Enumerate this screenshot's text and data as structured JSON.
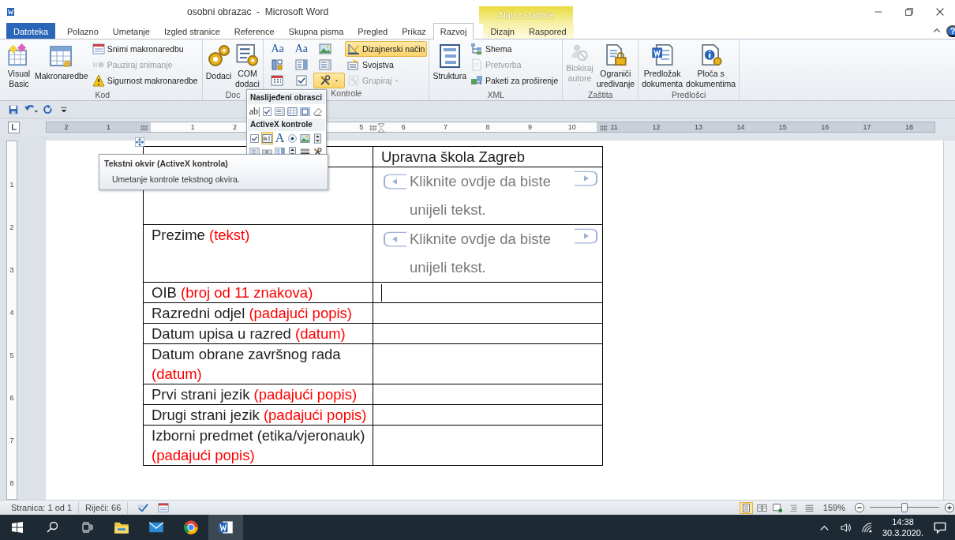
{
  "window": {
    "title": "osobni obrazac  -  Microsoft Word",
    "context_group": "Alati za tablice"
  },
  "tabs": [
    {
      "label": "Datoteka",
      "kind": "file",
      "selected": false
    },
    {
      "label": "Polazno",
      "kind": "tab",
      "selected": false
    },
    {
      "label": "Umetanje",
      "kind": "tab",
      "selected": false
    },
    {
      "label": "Izgled stranice",
      "kind": "tab",
      "selected": false
    },
    {
      "label": "Reference",
      "kind": "tab",
      "selected": false
    },
    {
      "label": "Skupna pisma",
      "kind": "tab",
      "selected": false
    },
    {
      "label": "Pregled",
      "kind": "tab",
      "selected": false
    },
    {
      "label": "Prikaz",
      "kind": "tab",
      "selected": false
    },
    {
      "label": "Razvoj",
      "kind": "tab",
      "selected": true
    },
    {
      "label": "Dizajn",
      "kind": "context",
      "selected": false
    },
    {
      "label": "Raspored",
      "kind": "context",
      "selected": false
    }
  ],
  "help_label": "?",
  "ribbon": {
    "groups": [
      {
        "label": "Kod",
        "columns": [
          {
            "kind": "large",
            "items": [
              {
                "kind": "vb",
                "label": "Visual\nBasic",
                "disabled": false,
                "on": false,
                "dropdown": false
              }
            ]
          },
          {
            "kind": "large",
            "items": [
              {
                "kind": "sheet",
                "label": "Makronaredbe",
                "disabled": false,
                "on": false,
                "dropdown": false
              }
            ]
          },
          {
            "kind": "small",
            "items": [
              {
                "kind": "record",
                "label": "Snimi makronaredbu",
                "disabled": false,
                "on": false,
                "dropdown": false
              },
              {
                "kind": "pause",
                "label": "Pauziraj snimanje",
                "disabled": true,
                "on": false,
                "dropdown": false
              },
              {
                "kind": "warning",
                "label": "Sigurnost makronaredbe",
                "disabled": false,
                "on": false,
                "dropdown": false
              }
            ]
          }
        ]
      },
      {
        "label": "Doc",
        "columns": [
          {
            "kind": "large",
            "items": [
              {
                "kind": "gears",
                "label": "Dodaci",
                "disabled": false,
                "on": false,
                "dropdown": false
              }
            ]
          },
          {
            "kind": "large",
            "items": [
              {
                "kind": "listgear",
                "label": "COM\ndodaci",
                "disabled": false,
                "on": false,
                "dropdown": false
              }
            ]
          }
        ]
      },
      {
        "label": "Kontrole",
        "columns": [
          {
            "kind": "small",
            "items": [
              {
                "kind": "glyph",
                "text": "Aa",
                "disabled": false,
                "on": false,
                "dropdown": false
              },
              {
                "kind": "blocks",
                "disabled": false,
                "on": false,
                "dropdown": false
              },
              {
                "kind": "calendar",
                "disabled": false,
                "on": false,
                "dropdown": false
              }
            ]
          },
          {
            "kind": "small",
            "items": [
              {
                "kind": "glyph",
                "text": "Aa",
                "disabled": false,
                "on": false,
                "dropdown": false
              },
              {
                "kind": "combo",
                "disabled": false,
                "on": false,
                "dropdown": false
              },
              {
                "kind": "checkbox",
                "disabled": false,
                "on": false,
                "dropdown": false
              }
            ]
          },
          {
            "kind": "small",
            "items": [
              {
                "kind": "picture",
                "disabled": false,
                "on": false,
                "dropdown": false
              },
              {
                "kind": "listbox",
                "disabled": false,
                "on": false,
                "dropdown": false
              },
              {
                "kind": "tools",
                "disabled": false,
                "on": true,
                "dropdown": true
              }
            ]
          },
          {
            "kind": "small",
            "items": [
              {
                "kind": "design",
                "label": "Dizajnerski način",
                "disabled": false,
                "on": true,
                "dropdown": false
              },
              {
                "kind": "props",
                "label": "Svojstva",
                "disabled": false,
                "on": false,
                "dropdown": false
              },
              {
                "kind": "group",
                "label": "Grupiraj",
                "disabled": true,
                "on": false,
                "dropdown": true
              }
            ]
          }
        ]
      },
      {
        "label": "XML",
        "columns": [
          {
            "kind": "large",
            "items": [
              {
                "kind": "tree",
                "label": "Struktura",
                "disabled": false,
                "on": false,
                "dropdown": false
              }
            ]
          },
          {
            "kind": "small",
            "items": [
              {
                "kind": "schema",
                "label": "Shema",
                "disabled": false,
                "on": false,
                "dropdown": false
              },
              {
                "kind": "doc",
                "label": "Pretvorba",
                "disabled": true,
                "on": false,
                "dropdown": false
              },
              {
                "kind": "packages",
                "label": "Paketi za proširenje",
                "disabled": false,
                "on": false,
                "dropdown": false
              }
            ]
          }
        ]
      },
      {
        "label": "Zaštita",
        "columns": [
          {
            "kind": "large",
            "items": [
              {
                "kind": "blockuser",
                "label": "Blokiraj\nautore",
                "disabled": true,
                "on": false,
                "dropdown": true
              }
            ]
          },
          {
            "kind": "large",
            "items": [
              {
                "kind": "lockdoc",
                "label": "Ograniči\nuređivanje",
                "disabled": false,
                "on": false,
                "dropdown": false
              }
            ]
          }
        ]
      },
      {
        "label": "Predlošci",
        "columns": [
          {
            "kind": "large",
            "items": [
              {
                "kind": "worddoc",
                "label": "Predložak\ndokumenta",
                "disabled": false,
                "on": false,
                "dropdown": false
              }
            ]
          },
          {
            "kind": "large",
            "items": [
              {
                "kind": "infodoc",
                "label": "Ploča s\ndokumentima",
                "disabled": false,
                "on": false,
                "dropdown": false
              }
            ]
          }
        ]
      }
    ]
  },
  "quick_access": [
    {
      "kind": "save"
    },
    {
      "kind": "undo"
    },
    {
      "kind": "redo"
    },
    {
      "kind": "customize"
    }
  ],
  "ruler": {
    "left_numbers": [
      "2",
      "1"
    ],
    "numbers_before_menu": [
      "1",
      "2"
    ],
    "numbers_after_menu": [
      "5",
      "6",
      "7",
      "8",
      "9",
      "10",
      "11",
      "12",
      "13",
      "14",
      "15",
      "16",
      "17",
      "18"
    ]
  },
  "vertical_ruler": [
    "1",
    "2",
    "3",
    "4",
    "5",
    "6",
    "7",
    "8"
  ],
  "gallery": {
    "legacy_title": "Naslijeđeni obrasci",
    "legacy": [
      {
        "kind": "glyph",
        "text": "ab|"
      },
      {
        "kind": "checkbox"
      },
      {
        "kind": "listbox"
      },
      {
        "kind": "frame"
      },
      {
        "kind": "shading"
      },
      {
        "kind": "eraser"
      }
    ],
    "activex_title": "ActiveX kontrole",
    "activex": [
      {
        "kind": "checkbox",
        "selected": false
      },
      {
        "kind": "textbox",
        "selected": true
      },
      {
        "kind": "glyph",
        "text": "A",
        "selected": false
      },
      {
        "kind": "radio",
        "selected": false
      },
      {
        "kind": "picture",
        "selected": false
      },
      {
        "kind": "spin",
        "selected": false
      },
      {
        "kind": "listbox",
        "selected": false
      },
      {
        "kind": "scroll",
        "selected": false
      },
      {
        "kind": "combo",
        "selected": false
      },
      {
        "kind": "spin",
        "selected": false
      },
      {
        "kind": "toggle",
        "selected": false
      },
      {
        "kind": "tools",
        "selected": false
      }
    ]
  },
  "tooltip": {
    "title": "Tekstni okvir (ActiveX kontrola)",
    "text": "Umetanje kontrole tekstnog okvira."
  },
  "document": {
    "rows": [
      {
        "kind": "text",
        "value": "Upravna škola Zagreb"
      },
      {
        "kind": "placeholder",
        "value": "Kliknite ovdje da biste unijeli tekst."
      },
      {
        "label": "Prezime",
        "hint": "(tekst)",
        "kind": "placeholder",
        "value": "Kliknite ovdje da biste unijeli tekst."
      },
      {
        "label": "OIB",
        "hint": "(broj od 11 znakova)",
        "kind": "cursor"
      },
      {
        "label": "Razredni odjel",
        "hint": "(padajući popis)",
        "kind": "empty"
      },
      {
        "label": "Datum upisa u razred",
        "hint": "(datum)",
        "kind": "empty"
      },
      {
        "label": "Datum obrane završnog rada",
        "hint": "(datum)",
        "kind": "empty"
      },
      {
        "label": "Prvi strani jezik",
        "hint": "(padajući popis)",
        "kind": "empty"
      },
      {
        "label": "Drugi strani jezik",
        "hint": "(padajući popis)",
        "kind": "empty"
      },
      {
        "label": "Izborni predmet (etika/vjeronauk)",
        "hint": "(padajući popis)",
        "kind": "empty"
      }
    ]
  },
  "status_bar": {
    "page": "Stranica: 1 od 1",
    "words": "Riječi: 66",
    "views": [
      {
        "kind": "print",
        "selected": true
      },
      {
        "kind": "reading",
        "selected": false
      },
      {
        "kind": "web",
        "selected": false
      },
      {
        "kind": "outline",
        "selected": false
      },
      {
        "kind": "draft",
        "selected": false
      }
    ],
    "zoom": "159%",
    "zoom_slider": {
      "level": 0.5
    }
  },
  "taskbar": {
    "apps": [
      {
        "kind": "explorer",
        "active": false
      },
      {
        "kind": "mail",
        "active": false
      },
      {
        "kind": "browser",
        "active": false
      },
      {
        "kind": "word",
        "active": true
      }
    ],
    "time": "14:38",
    "date": "30.3.2020."
  }
}
